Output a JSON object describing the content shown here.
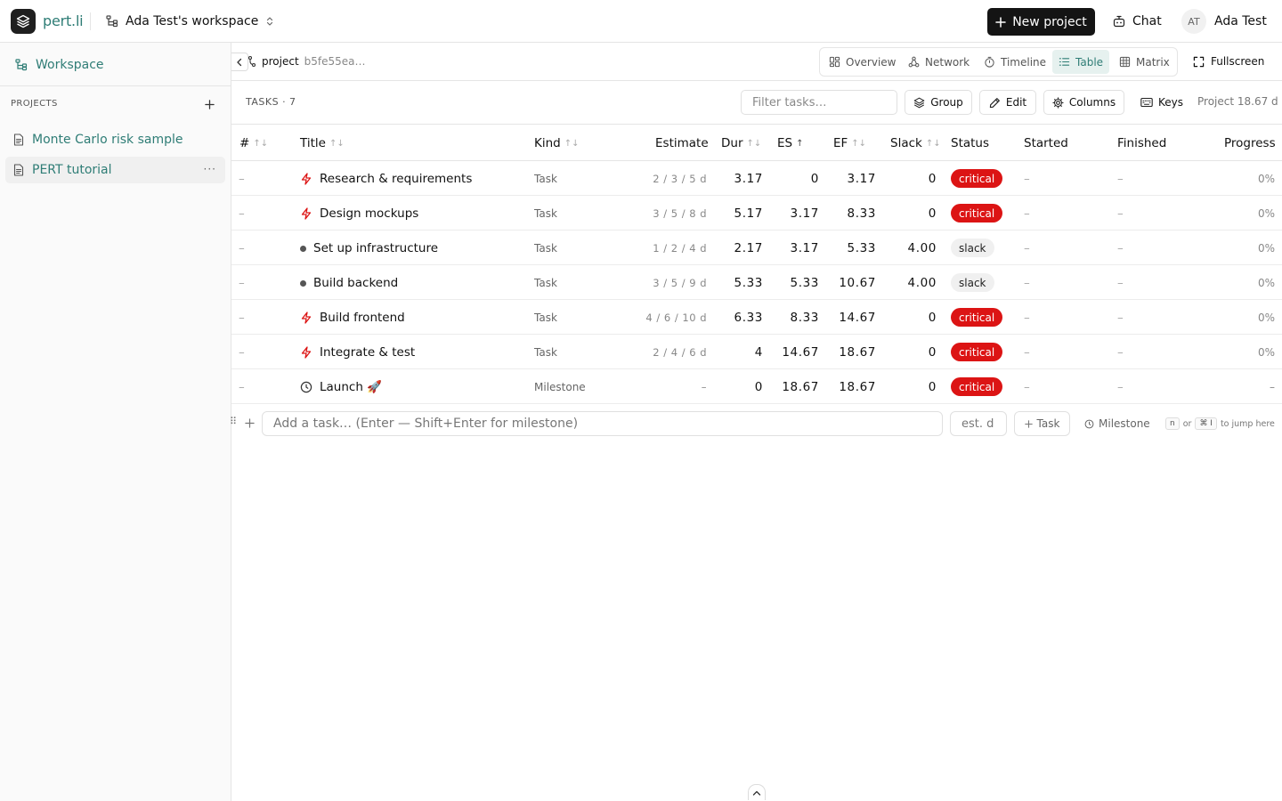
{
  "app": {
    "name": "pert.li"
  },
  "header": {
    "workspace_name": "Ada Test's workspace",
    "new_project_label": "New project",
    "chat_label": "Chat",
    "user_initials": "AT",
    "user_name": "Ada Test"
  },
  "sidebar": {
    "workspace_label": "Workspace",
    "projects_heading": "PROJECTS",
    "projects": [
      {
        "name": "Monte Carlo risk sample"
      },
      {
        "name": "PERT tutorial"
      }
    ],
    "more_label": "···"
  },
  "subheader": {
    "crumb_label": "project",
    "project_id": "b5fe55ea…",
    "tabs": [
      {
        "label": "Overview",
        "icon": "overview-icon"
      },
      {
        "label": "Network",
        "icon": "network-icon"
      },
      {
        "label": "Timeline",
        "icon": "timeline-icon"
      },
      {
        "label": "Table",
        "icon": "table-icon",
        "active": true
      },
      {
        "label": "Matrix",
        "icon": "matrix-icon"
      }
    ],
    "fullscreen_label": "Fullscreen"
  },
  "toolbar": {
    "tasks_count_label": "TASKS · 7",
    "filter_placeholder": "Filter tasks…",
    "group_label": "Group",
    "edit_label": "Edit",
    "columns_label": "Columns",
    "keys_label": "Keys",
    "project_duration": "Project 18.67 d"
  },
  "table": {
    "columns": {
      "index": "#",
      "title": "Title",
      "kind": "Kind",
      "estimate": "Estimate",
      "dur": "Dur",
      "es": "ES",
      "ef": "EF",
      "slack": "Slack",
      "status": "Status",
      "started": "Started",
      "finished": "Finished",
      "progress": "Progress"
    },
    "rows": [
      {
        "index": "–",
        "icon": "critical-bolt-icon",
        "title": "Research & requirements",
        "kind": "Task",
        "estimate": "2 / 3 / 5 d",
        "dur": "3.17",
        "es": "0",
        "ef": "3.17",
        "slack": "0",
        "status": "critical",
        "started": "–",
        "finished": "–",
        "progress": "0%"
      },
      {
        "index": "–",
        "icon": "critical-bolt-icon",
        "title": "Design mockups",
        "kind": "Task",
        "estimate": "3 / 5 / 8 d",
        "dur": "5.17",
        "es": "3.17",
        "ef": "8.33",
        "slack": "0",
        "status": "critical",
        "started": "–",
        "finished": "–",
        "progress": "0%"
      },
      {
        "index": "–",
        "icon": "dot-icon",
        "title": "Set up infrastructure",
        "kind": "Task",
        "estimate": "1 / 2 / 4 d",
        "dur": "2.17",
        "es": "3.17",
        "ef": "5.33",
        "slack": "4.00",
        "status": "slack",
        "started": "–",
        "finished": "–",
        "progress": "0%"
      },
      {
        "index": "–",
        "icon": "dot-icon",
        "title": "Build backend",
        "kind": "Task",
        "estimate": "3 / 5 / 9 d",
        "dur": "5.33",
        "es": "5.33",
        "ef": "10.67",
        "slack": "4.00",
        "status": "slack",
        "started": "–",
        "finished": "–",
        "progress": "0%"
      },
      {
        "index": "–",
        "icon": "critical-bolt-icon",
        "title": "Build frontend",
        "kind": "Task",
        "estimate": "4 / 6 / 10 d",
        "dur": "6.33",
        "es": "8.33",
        "ef": "14.67",
        "slack": "0",
        "status": "critical",
        "started": "–",
        "finished": "–",
        "progress": "0%"
      },
      {
        "index": "–",
        "icon": "critical-bolt-icon",
        "title": "Integrate & test",
        "kind": "Task",
        "estimate": "2 / 4 / 6 d",
        "dur": "4",
        "es": "14.67",
        "ef": "18.67",
        "slack": "0",
        "status": "critical",
        "started": "–",
        "finished": "–",
        "progress": "0%"
      },
      {
        "index": "–",
        "icon": "milestone-icon",
        "title": "Launch 🚀",
        "kind": "Milestone",
        "estimate": "–",
        "dur": "0",
        "es": "18.67",
        "ef": "18.67",
        "slack": "0",
        "status": "critical",
        "started": "–",
        "finished": "–",
        "progress": "–"
      }
    ]
  },
  "add_row": {
    "drag_glyph": "⠿",
    "task_placeholder": "Add a task… (Enter — Shift+Enter for milestone)",
    "est_placeholder": "est. d",
    "add_task_label": "Task",
    "add_milestone_label": "Milestone",
    "hint_key1": "n",
    "hint_or": "or",
    "hint_key2": "⌘ I",
    "hint_suffix": "to jump here"
  },
  "colors": {
    "accent": "#2f7d76",
    "critical": "#dc1414",
    "primary_button": "#141414"
  }
}
